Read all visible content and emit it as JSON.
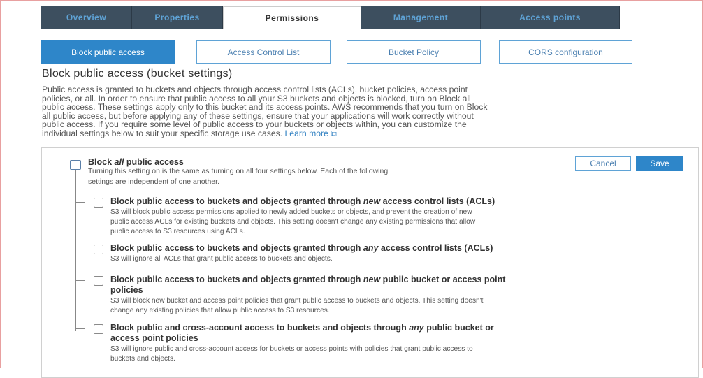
{
  "tabs": [
    {
      "label": "Overview",
      "active": false
    },
    {
      "label": "Properties",
      "active": false
    },
    {
      "label": "Permissions",
      "active": true
    },
    {
      "label": "Management",
      "active": false
    },
    {
      "label": "Access points",
      "active": false
    }
  ],
  "subnav": [
    {
      "label": "Block public access",
      "active": true
    },
    {
      "label": "Access Control List",
      "active": false
    },
    {
      "label": "Bucket Policy",
      "active": false
    },
    {
      "label": "CORS configuration",
      "active": false
    }
  ],
  "section": {
    "title": "Block public access (bucket settings)",
    "description_lines": [
      "Public access is granted to buckets and objects through access control lists (ACLs), bucket policies, access point",
      "policies, or all. In order to ensure that public access to all your S3 buckets and objects is blocked, turn on Block all",
      "public access. These settings apply only to this bucket and its access points. AWS recommends that you turn on Block",
      "all public access, but before applying any of these settings, ensure that your applications will work correctly without",
      "public access. If you require some level of public access to your buckets or objects within, you can customize the",
      "individual settings below to suit your specific storage use cases."
    ],
    "learn_more": "Learn more ⧉"
  },
  "actions": {
    "cancel": "Cancel",
    "save": "Save"
  },
  "block_all": {
    "title_pre": "Block ",
    "title_em": "all",
    "title_post": " public access",
    "desc_line1": "Turning this setting on is the same as turning on all four settings below. Each of the following",
    "desc_line2": "settings are independent of one another.",
    "checked": false
  },
  "options": [
    {
      "title_pre": "Block public access to buckets and objects granted through ",
      "title_em": "new",
      "title_post": " access control lists (ACLs)",
      "desc": [
        "S3 will block public access permissions applied to newly added buckets or objects, and prevent the creation of new",
        "public access ACLs for existing buckets and objects. This setting doesn't change any existing permissions that allow",
        "public access to S3 resources using ACLs."
      ],
      "checked": false
    },
    {
      "title_pre": "Block public access to buckets and objects granted through ",
      "title_em": "any",
      "title_post": " access control lists (ACLs)",
      "desc": [
        "S3 will ignore all ACLs that grant public access to buckets and objects."
      ],
      "checked": false
    },
    {
      "title_pre": "Block public access to buckets and objects granted through ",
      "title_em": "new",
      "title_post": " public bucket or access point",
      "title_line2": "policies",
      "desc": [
        "S3 will block new bucket and access point policies that grant public access to buckets and objects. This setting doesn't",
        "change any existing policies that allow public access to S3 resources."
      ],
      "checked": false
    },
    {
      "title_pre": "Block public and cross-account access to buckets and objects through ",
      "title_em": "any",
      "title_post": " public bucket or",
      "title_line2": "access point policies",
      "desc": [
        "S3 will ignore public and cross-account access for buckets or access points with policies that grant public access to",
        "buckets and objects."
      ],
      "checked": false
    }
  ]
}
